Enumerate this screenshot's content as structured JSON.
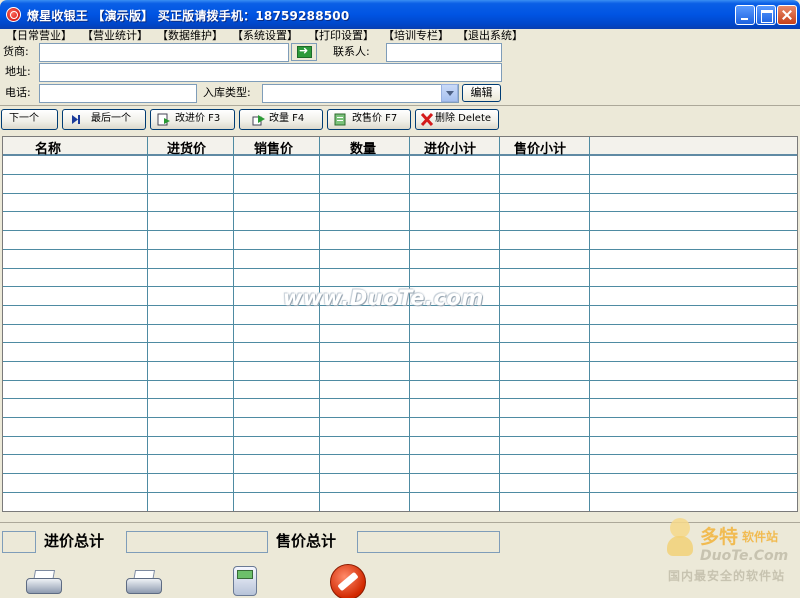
{
  "window": {
    "title": "燎星收银王 【演示版】 买正版请拨手机：18759288500"
  },
  "menu": [
    "【日常营业】",
    "【营业统计】",
    "【数据维护】",
    "【系统设置】",
    "【打印设置】",
    "【培训专栏】",
    "【退出系统】"
  ],
  "form": {
    "supplier_label": "货商:",
    "contact_label": "联系人:",
    "address_label": "地址:",
    "phone_label": "电话:",
    "stock_type_label": "入库类型:",
    "edit_button": "编辑",
    "supplier_value": "",
    "contact_value": "",
    "address_value": "",
    "phone_value": "",
    "stock_type_value": ""
  },
  "toolbar": {
    "next": "下一个",
    "last": "最后一个",
    "change_cost": "改进价 F3",
    "change_qty": "改量 F4",
    "change_price": "改售价 F7",
    "delete": "删除 Delete"
  },
  "table": {
    "columns": [
      "名称",
      "进货价",
      "销售价",
      "数量",
      "进价小计",
      "售价小计"
    ],
    "rows": []
  },
  "totals": {
    "cost_total_label": "进价总计",
    "sale_total_label": "售价总计",
    "cost_total_value": "",
    "sale_total_value": ""
  },
  "watermark": {
    "center": "www.DuoTe.com",
    "logo_big": "多特",
    "logo_small": "软件站",
    "logo_en": "DuoTe.Com",
    "logo_cn": "国内最安全的软件站"
  },
  "icons": {
    "printer_1": "printer-icon",
    "printer_2": "printer-icon",
    "phone": "phone-icon",
    "stop": "stop-icon"
  }
}
